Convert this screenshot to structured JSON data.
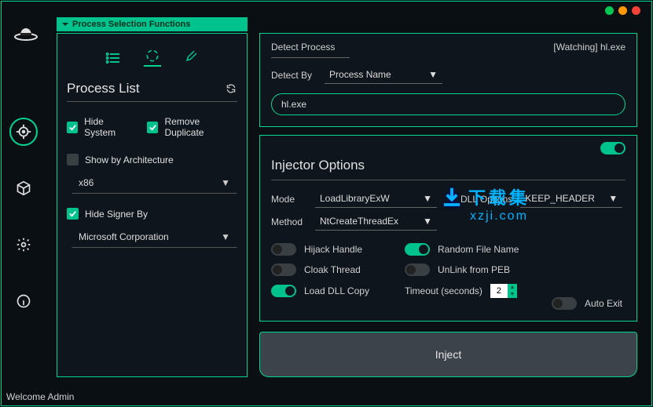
{
  "header": {
    "section_title": "Process Selection Functions"
  },
  "process_list": {
    "title": "Process List",
    "hide_system_label": "Hide System",
    "hide_system_checked": true,
    "remove_dup_label": "Remove Duplicate",
    "remove_dup_checked": true,
    "show_arch_label": "Show by Architecture",
    "show_arch_checked": false,
    "arch_value": "x86",
    "hide_signer_label": "Hide Signer By",
    "hide_signer_checked": true,
    "signer_value": "Microsoft Corporation"
  },
  "detect": {
    "title": "Detect Process",
    "watching_label": "[Watching] hl.exe",
    "detect_by_label": "Detect By",
    "detect_by_value": "Process Name",
    "process_value": "hl.exe"
  },
  "injector": {
    "enabled": true,
    "title": "Injector Options",
    "mode_label": "Mode",
    "mode_value": "LoadLibraryExW",
    "dll_opt_label": "DLL Options",
    "dll_opt_value": "KEEP_HEADER",
    "method_label": "Method",
    "method_value": "NtCreateThreadEx",
    "hijack_label": "Hijack Handle",
    "hijack_on": false,
    "random_label": "Random File Name",
    "random_on": true,
    "cloak_label": "Cloak Thread",
    "cloak_on": false,
    "unlink_label": "UnLink from PEB",
    "unlink_on": false,
    "loaddll_label": "Load DLL Copy",
    "loaddll_on": true,
    "timeout_label": "Timeout (seconds)",
    "timeout_value": "2",
    "auto_exit_label": "Auto Exit",
    "auto_exit_on": false
  },
  "inject_button": "Inject",
  "status_bar": "Welcome Admin",
  "watermark": {
    "line1": "下载集",
    "line2": "xzji.com"
  }
}
